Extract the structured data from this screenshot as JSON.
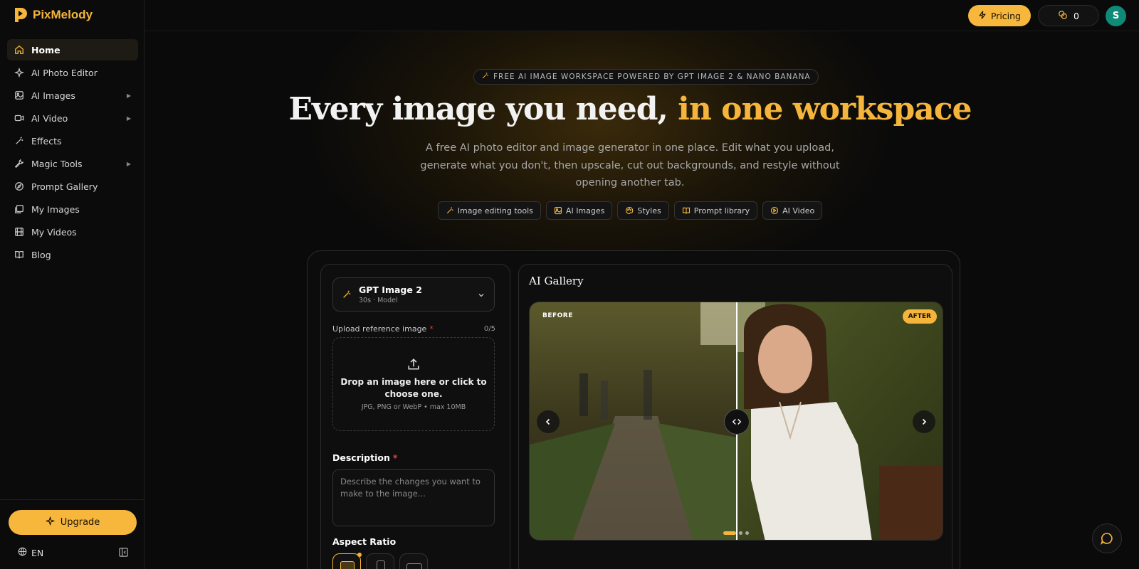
{
  "app": {
    "name": "PixMelody",
    "brand_color": "#f5b53c"
  },
  "sidebar": {
    "items": [
      {
        "label": "Home",
        "icon": "home-icon",
        "active": true
      },
      {
        "label": "AI Photo Editor",
        "icon": "sparkle-icon"
      },
      {
        "label": "AI Images",
        "icon": "image-icon",
        "submenu": true
      },
      {
        "label": "AI Video",
        "icon": "video-icon",
        "submenu": true
      },
      {
        "label": "Effects",
        "icon": "wand-icon"
      },
      {
        "label": "Magic Tools",
        "icon": "wrench-icon",
        "submenu": true
      },
      {
        "label": "Prompt Gallery",
        "icon": "compass-icon"
      },
      {
        "label": "My Images",
        "icon": "images-icon"
      },
      {
        "label": "My Videos",
        "icon": "film-icon"
      },
      {
        "label": "Blog",
        "icon": "book-icon"
      }
    ],
    "upgrade_label": "Upgrade",
    "language": "EN"
  },
  "topbar": {
    "pricing_label": "Pricing",
    "credits": "0",
    "avatar_initial": "S"
  },
  "hero": {
    "badge": "FREE AI IMAGE WORKSPACE POWERED BY GPT IMAGE 2 & NANO BANANA",
    "title_main": "Every image you need, ",
    "title_accent": "in one workspace",
    "subtitle": "A free AI photo editor and image generator in one place. Edit what you upload, generate what you don't, then upscale, cut out backgrounds, and restyle without opening another tab.",
    "chips": [
      {
        "label": "Image editing tools",
        "icon": "wand-icon"
      },
      {
        "label": "AI Images",
        "icon": "image-icon"
      },
      {
        "label": "Styles",
        "icon": "palette-icon"
      },
      {
        "label": "Prompt library",
        "icon": "book-icon"
      },
      {
        "label": "AI Video",
        "icon": "play-icon"
      }
    ]
  },
  "editor": {
    "model_name": "GPT Image 2",
    "model_meta": "30s · Model",
    "upload_label": "Upload reference image",
    "upload_count": "0/5",
    "drop_title": "Drop an image here or click to choose one.",
    "drop_hint": "JPG, PNG or WebP • max 10MB",
    "description_label": "Description",
    "description_placeholder": "Describe the changes you want to make to the image...",
    "aspect_label": "Aspect Ratio"
  },
  "gallery": {
    "title": "AI Gallery",
    "before_label": "BEFORE",
    "after_label": "AFTER"
  }
}
